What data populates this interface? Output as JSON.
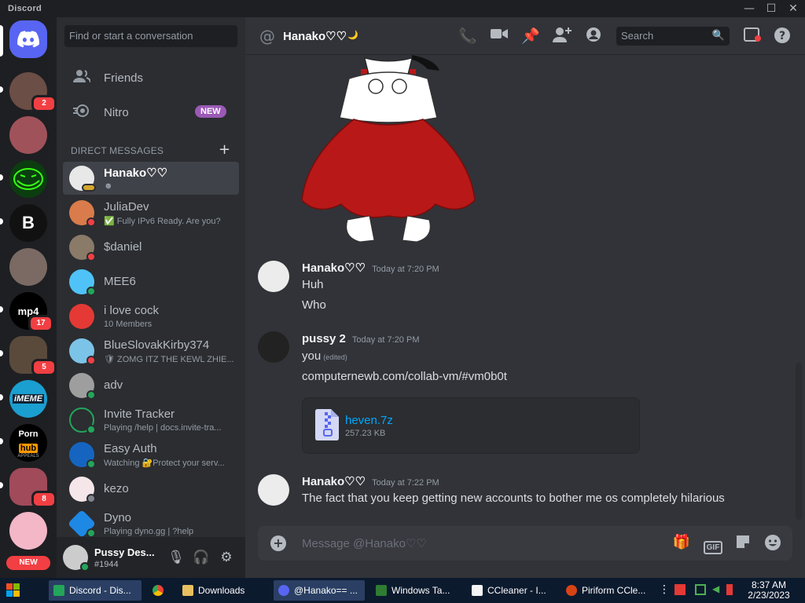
{
  "window": {
    "brand": "Discord",
    "controls": [
      "—",
      "☐",
      "✕"
    ]
  },
  "guilds": {
    "badges": [
      "2",
      "17",
      "5",
      "8"
    ],
    "bitcoin_letter": "B",
    "mp4_label": "mp4",
    "meme_label": "iMEME",
    "porn_top": "Porn",
    "hub_label": "hub",
    "appeals_label": "APPEALS",
    "new_badge": "NEW"
  },
  "sidebar": {
    "search_placeholder": "Find or start a conversation",
    "friends": "Friends",
    "nitro": "Nitro",
    "nitro_badge": "NEW",
    "dm_header": "DIRECT MESSAGES",
    "dms": [
      {
        "name": "Hanako♡♡",
        "sub": ""
      },
      {
        "name": "JuliaDev",
        "sub": "✅ Fully IPv6 Ready. Are you?"
      },
      {
        "name": "$daniel",
        "sub": ""
      },
      {
        "name": "MEE6",
        "sub": ""
      },
      {
        "name": "i love cock",
        "sub": "10 Members"
      },
      {
        "name": "BlueSlovakKirby374",
        "sub": "🛡 ZOMG ITZ THE KEWL ZHIE..."
      },
      {
        "name": "adv",
        "sub": ""
      },
      {
        "name": "Invite Tracker",
        "sub": "Playing /help | docs.invite-tra..."
      },
      {
        "name": "Easy Auth",
        "sub": "Watching 🔐Protect your serv..."
      },
      {
        "name": "kezo",
        "sub": ""
      },
      {
        "name": "Dyno",
        "sub": "Playing dyno.gg | ?help"
      }
    ],
    "user": {
      "name": "Pussy Des...",
      "tag": "#1944"
    }
  },
  "chat": {
    "header_name": "Hanako♡♡",
    "header_moon": "🌙",
    "search_placeholder": "Search",
    "messages": [
      {
        "author": "Hanako♡♡",
        "time": "Today at 7:20 PM",
        "lines": [
          "Huh",
          "Who"
        ]
      },
      {
        "author": "pussy 2",
        "time": "Today at 7:20 PM",
        "lines": [
          "you",
          "computernewb.com/collab-vm/#vm0b0t"
        ],
        "edited": "(edited)"
      },
      {
        "author": "Hanako♡♡",
        "time": "Today at 7:22 PM",
        "lines": [
          "The fact that you keep getting new accounts to bother me os completely hilarious"
        ]
      }
    ],
    "attachment": {
      "name": "heven.7z",
      "size": "257.23 KB"
    },
    "composer_placeholder": "Message @Hanako♡♡",
    "gif_label": "GIF"
  },
  "taskbar": {
    "items": [
      "Discord - Dis...",
      "",
      "Downloads",
      "@Hanako== ...",
      "Windows Ta...",
      "CCleaner - I...",
      "Piriform CCle..."
    ],
    "time": "8:37 AM",
    "date": "2/23/2023"
  },
  "colors": {
    "blurple": "#5865f2",
    "online": "#23a55a",
    "dnd": "#f23f43",
    "link": "#00a8fc",
    "bg_chat": "#313338",
    "bg_sidebar": "#2b2d31"
  }
}
